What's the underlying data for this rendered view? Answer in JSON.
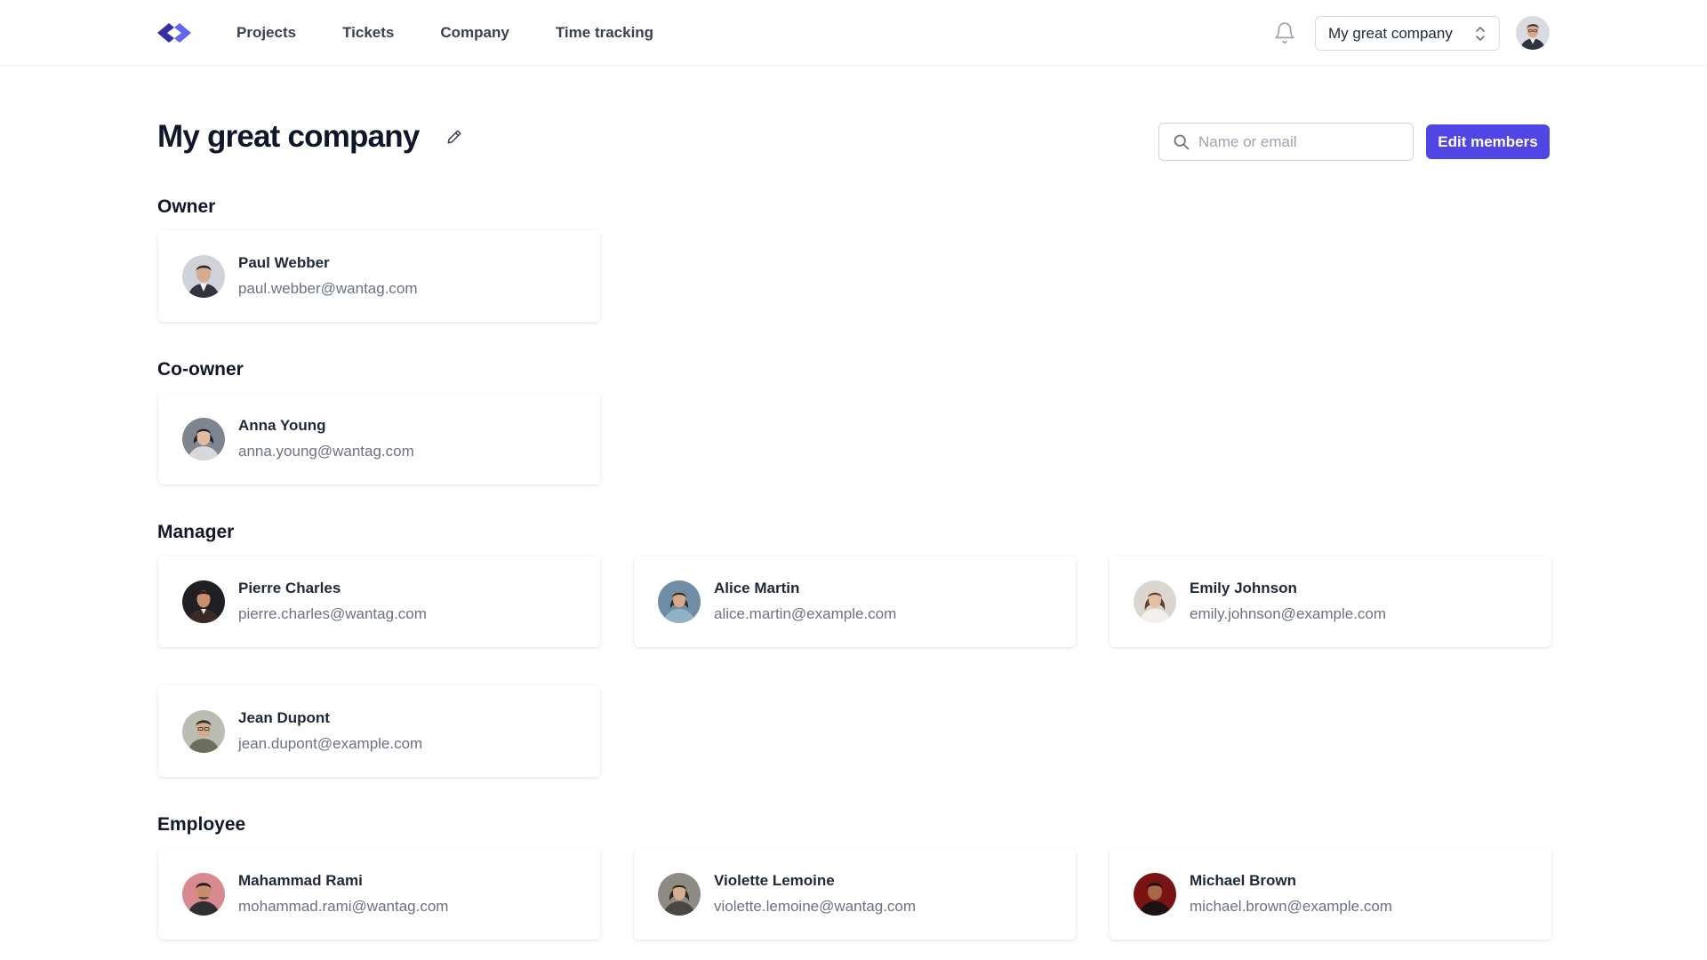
{
  "nav": {
    "items": [
      "Projects",
      "Tickets",
      "Company",
      "Time tracking"
    ],
    "company_selector": "My great company"
  },
  "header": {
    "title": "My great company",
    "search_placeholder": "Name or email",
    "edit_members_label": "Edit members"
  },
  "colors": {
    "accent": "#4f46e5",
    "logo_dark": "#3730a3",
    "logo_light": "#6366f1"
  },
  "sections": {
    "owner": {
      "title": "Owner",
      "members": [
        {
          "name": "Paul Webber",
          "email": "paul.webber@wantag.com"
        }
      ]
    },
    "coowner": {
      "title": "Co-owner",
      "members": [
        {
          "name": "Anna Young",
          "email": "anna.young@wantag.com"
        }
      ]
    },
    "manager": {
      "title": "Manager",
      "members": [
        {
          "name": "Pierre Charles",
          "email": "pierre.charles@wantag.com"
        },
        {
          "name": "Alice Martin",
          "email": "alice.martin@example.com"
        },
        {
          "name": "Emily Johnson",
          "email": "emily.johnson@example.com"
        },
        {
          "name": "Jean Dupont",
          "email": "jean.dupont@example.com"
        }
      ]
    },
    "employee": {
      "title": "Employee",
      "members": [
        {
          "name": "Mahammad Rami",
          "email": "mohammad.rami@wantag.com"
        },
        {
          "name": "Violette Lemoine",
          "email": "violette.lemoine@wantag.com"
        },
        {
          "name": "Michael Brown",
          "email": "michael.brown@example.com"
        }
      ]
    }
  }
}
